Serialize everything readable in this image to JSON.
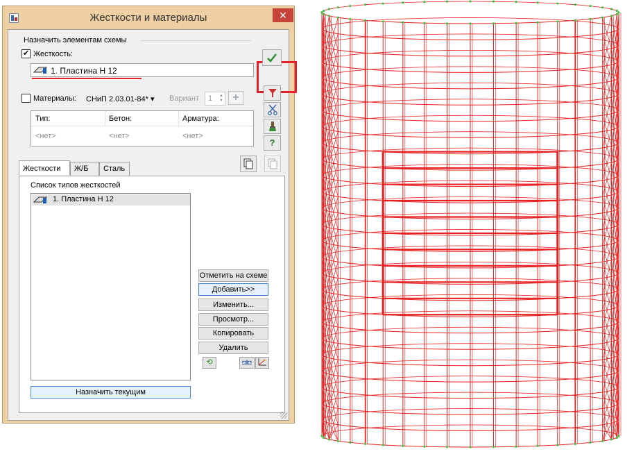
{
  "window": {
    "title": "Жесткости и материалы",
    "close_glyph": "✕"
  },
  "assign_group": {
    "caption": "Назначить элементам схемы",
    "stiffness_label": "Жесткость:",
    "stiffness_checked": true,
    "stiffness_value": "1. Пластина  Н 12"
  },
  "materials": {
    "label": "Материалы:",
    "checked": false,
    "norm": "СНиП 2.03.01-84*",
    "variant_label": "Вариант",
    "variant_value": "1",
    "columns": [
      "Тип:",
      "Бетон:",
      "Арматура:"
    ],
    "values": [
      "<нет>",
      "<нет>",
      "<нет>"
    ]
  },
  "tabs": [
    {
      "label": "Жесткости",
      "active": true
    },
    {
      "label": "Ж/Б",
      "active": false
    },
    {
      "label": "Сталь",
      "active": false
    }
  ],
  "stiffness_list": {
    "caption": "Список типов жесткостей",
    "items": [
      "1. Пластина  Н 12"
    ]
  },
  "buttons": {
    "mark_on_scheme": "Отметить на схеме",
    "add": "Добавить>>",
    "edit": "Изменить...",
    "view": "Просмотр...",
    "copy": "Копировать",
    "delete": "Удалить",
    "assign_current": "Назначить текущим"
  },
  "colors": {
    "title_bar": "#efcfa4",
    "close_button": "#c7433a",
    "highlight": "#e0202a",
    "mesh_line": "#e82020",
    "node": "#40c040"
  },
  "icons": {
    "ok": "check-icon",
    "filter": "filter-icon",
    "scissors": "scissors-icon",
    "brush": "brush-icon",
    "help": "help-icon",
    "copy_doc": "copy-document-icon",
    "paste_doc": "paste-document-icon",
    "refresh": "refresh-icon",
    "transfer": "transfer-icon",
    "axes": "axes-icon"
  }
}
